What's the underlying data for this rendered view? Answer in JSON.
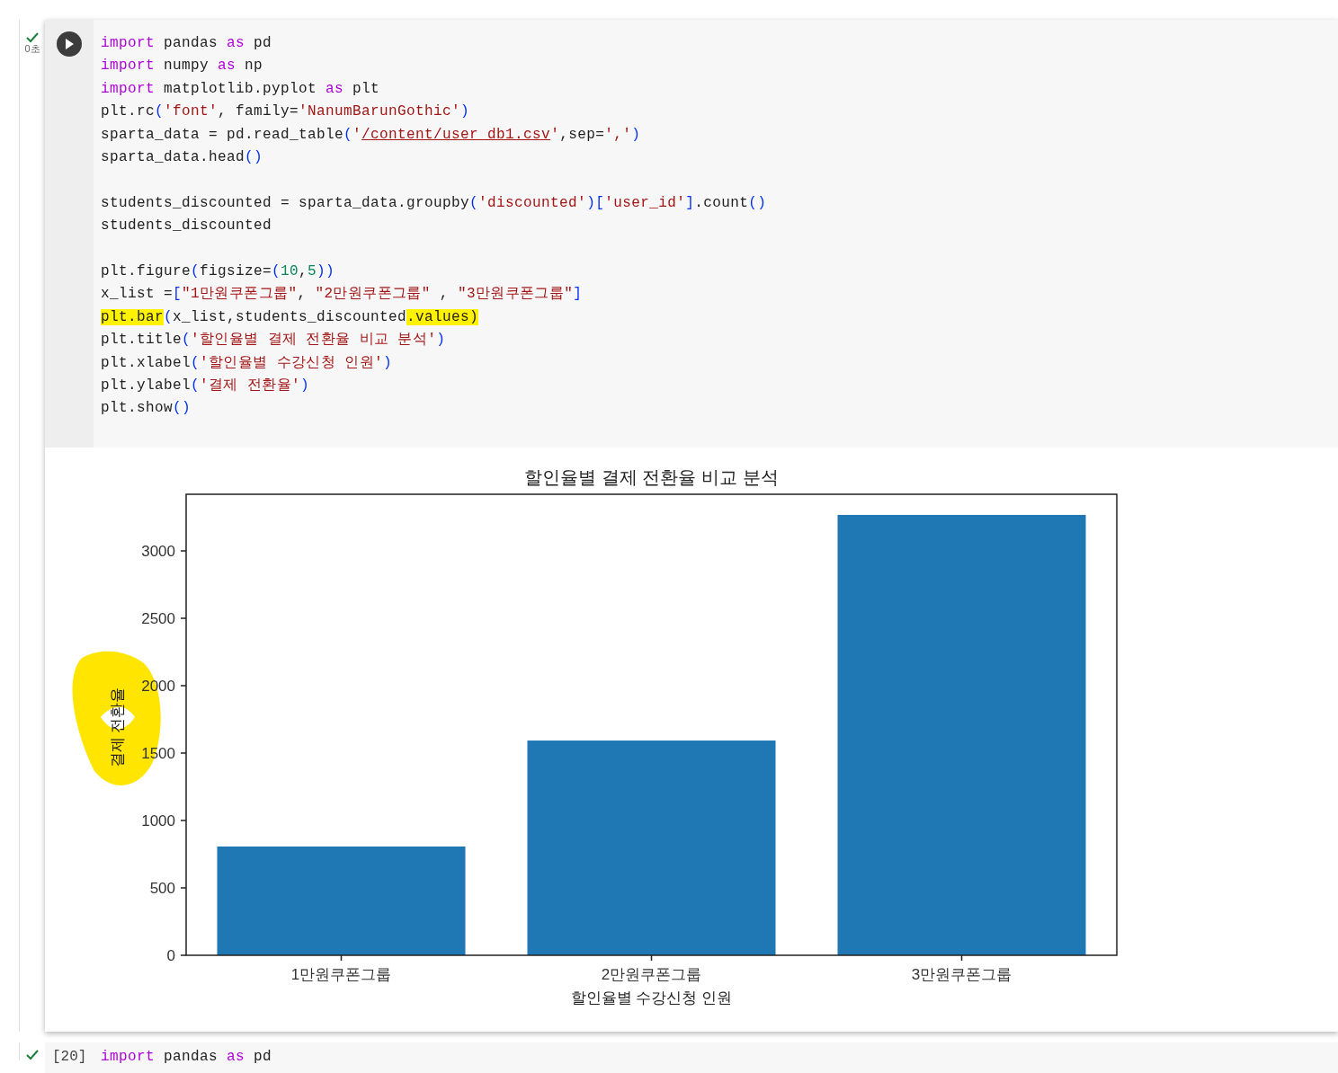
{
  "cell": {
    "succeeded": true,
    "exec_time": "0초",
    "lines": [
      {
        "kind": "code",
        "tokens": [
          {
            "kind": "kw",
            "text": "import"
          },
          {
            "kind": "plain",
            "text": " pandas "
          },
          {
            "kind": "kw",
            "text": "as"
          },
          {
            "kind": "plain",
            "text": " pd"
          }
        ]
      },
      {
        "kind": "code",
        "tokens": [
          {
            "kind": "kw",
            "text": "import"
          },
          {
            "kind": "plain",
            "text": " numpy "
          },
          {
            "kind": "kw",
            "text": "as"
          },
          {
            "kind": "plain",
            "text": " np"
          }
        ]
      },
      {
        "kind": "code",
        "tokens": [
          {
            "kind": "kw",
            "text": "import"
          },
          {
            "kind": "plain",
            "text": " matplotlib.pyplot "
          },
          {
            "kind": "kw",
            "text": "as"
          },
          {
            "kind": "plain",
            "text": " plt"
          }
        ]
      },
      {
        "kind": "code",
        "tokens": [
          {
            "kind": "plain",
            "text": "plt.rc"
          },
          {
            "kind": "punct",
            "text": "("
          },
          {
            "kind": "str",
            "text": "'font'"
          },
          {
            "kind": "plain",
            "text": ", family="
          },
          {
            "kind": "str",
            "text": "'NanumBarunGothic'"
          },
          {
            "kind": "punct",
            "text": ")"
          }
        ]
      },
      {
        "kind": "code",
        "tokens": [
          {
            "kind": "plain",
            "text": "sparta_data = pd.read_table"
          },
          {
            "kind": "punct",
            "text": "("
          },
          {
            "kind": "str",
            "text": "'"
          },
          {
            "kind": "url",
            "text": "/content/user_db1.csv"
          },
          {
            "kind": "str",
            "text": "'"
          },
          {
            "kind": "plain",
            "text": ",sep="
          },
          {
            "kind": "str",
            "text": "','"
          },
          {
            "kind": "punct",
            "text": ")"
          }
        ]
      },
      {
        "kind": "code",
        "tokens": [
          {
            "kind": "plain",
            "text": "sparta_data.head"
          },
          {
            "kind": "punct",
            "text": "()"
          }
        ]
      },
      {
        "kind": "blank"
      },
      {
        "kind": "code",
        "tokens": [
          {
            "kind": "plain",
            "text": "students_discounted = sparta_data.groupby"
          },
          {
            "kind": "punct",
            "text": "("
          },
          {
            "kind": "str",
            "text": "'discounted'"
          },
          {
            "kind": "punct",
            "text": ")["
          },
          {
            "kind": "str",
            "text": "'user_id'"
          },
          {
            "kind": "punct",
            "text": "]"
          },
          {
            "kind": "plain",
            "text": ".count"
          },
          {
            "kind": "punct",
            "text": "()"
          }
        ]
      },
      {
        "kind": "code",
        "tokens": [
          {
            "kind": "plain",
            "text": "students_discounted"
          }
        ]
      },
      {
        "kind": "blank"
      },
      {
        "kind": "code",
        "tokens": [
          {
            "kind": "plain",
            "text": "plt.figure"
          },
          {
            "kind": "punct",
            "text": "("
          },
          {
            "kind": "plain",
            "text": "figsize="
          },
          {
            "kind": "punct",
            "text": "("
          },
          {
            "kind": "num",
            "text": "10"
          },
          {
            "kind": "plain",
            "text": ","
          },
          {
            "kind": "num",
            "text": "5"
          },
          {
            "kind": "punct",
            "text": "))"
          }
        ]
      },
      {
        "kind": "code",
        "tokens": [
          {
            "kind": "plain",
            "text": "x_list ="
          },
          {
            "kind": "punct",
            "text": "["
          },
          {
            "kind": "str",
            "text": "\"1만원쿠폰그룹\""
          },
          {
            "kind": "plain",
            "text": ", "
          },
          {
            "kind": "str",
            "text": "\"2만원쿠폰그룹\""
          },
          {
            "kind": "plain",
            "text": " , "
          },
          {
            "kind": "str",
            "text": "\"3만원쿠폰그룹\""
          },
          {
            "kind": "punct",
            "text": "]"
          }
        ]
      },
      {
        "kind": "code",
        "tokens": [
          {
            "kind": "marked",
            "text": "plt.bar"
          },
          {
            "kind": "punct",
            "text": "("
          },
          {
            "kind": "plain",
            "text": "x_list,students_discounted"
          },
          {
            "kind": "marked",
            "text": ".values)"
          }
        ]
      },
      {
        "kind": "code",
        "tokens": [
          {
            "kind": "plain",
            "text": "plt.title"
          },
          {
            "kind": "punct",
            "text": "("
          },
          {
            "kind": "str",
            "text": "'할인율별 결제 전환율 비교 분석'"
          },
          {
            "kind": "punct",
            "text": ")"
          }
        ]
      },
      {
        "kind": "code",
        "tokens": [
          {
            "kind": "plain",
            "text": "plt.xlabel"
          },
          {
            "kind": "punct",
            "text": "("
          },
          {
            "kind": "str",
            "text": "'할인율별 수강신청 인원'"
          },
          {
            "kind": "punct",
            "text": ")"
          }
        ]
      },
      {
        "kind": "code",
        "tokens": [
          {
            "kind": "plain",
            "text": "plt.ylabel"
          },
          {
            "kind": "punct",
            "text": "("
          },
          {
            "kind": "str",
            "text": "'결제 전환율'"
          },
          {
            "kind": "punct",
            "text": ")"
          }
        ]
      },
      {
        "kind": "code",
        "tokens": [
          {
            "kind": "plain",
            "text": "plt.show"
          },
          {
            "kind": "punct",
            "text": "()"
          }
        ]
      }
    ],
    "output": {
      "chart_data": {
        "type": "bar",
        "title": "할인율별 결제 전환율 비교 분석",
        "xlabel": "할인율별 수강신청 인원",
        "ylabel": "결제 전환율",
        "categories": [
          "1만원쿠폰그룹",
          "2만원쿠폰그룹",
          "3만원쿠폰그룹"
        ],
        "series": [
          {
            "color": "#1f77b4",
            "values": [
              807,
              1593,
              3267
            ]
          }
        ],
        "ylim": [
          0,
          3420
        ],
        "yticks": [
          0,
          500,
          1000,
          1500,
          2000,
          2500,
          3000
        ]
      }
    }
  },
  "next_cell": {
    "succeeded": true,
    "exec_count": "[20]",
    "tokens": [
      {
        "kind": "kw",
        "text": "import"
      },
      {
        "kind": "plain",
        "text": " pandas "
      },
      {
        "kind": "kw",
        "text": "as"
      },
      {
        "kind": "plain",
        "text": " pd"
      }
    ]
  }
}
